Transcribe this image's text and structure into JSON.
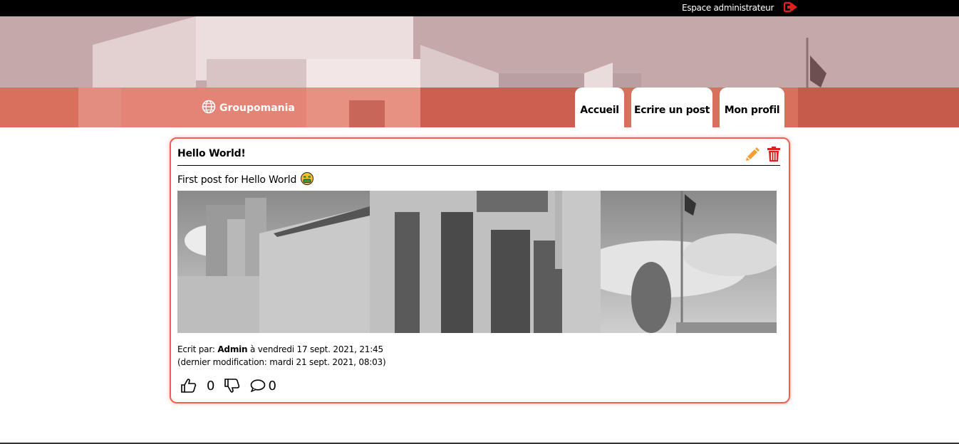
{
  "topbar": {
    "admin_label": "Espace administrateur",
    "logout_icon": "sign-out-icon"
  },
  "banner": {
    "brand_name": "Groupomania",
    "brand_icon": "globe-icon",
    "tabs": [
      {
        "label": "Accueil"
      },
      {
        "label": "Ecrire un post"
      },
      {
        "label": "Mon profil"
      }
    ]
  },
  "post": {
    "title": "Hello World!",
    "body": "First post for Hello World",
    "emoji": "money-mouth-face-icon",
    "meta_prefix": "Ecrit par:",
    "author": "Admin",
    "meta_date": "à vendredi 17 sept. 2021, 21:45",
    "modified": "(dernier modification: mardi 21 sept. 2021, 08:03)",
    "likes": "0",
    "comments": "0"
  },
  "colors": {
    "accent": "#f0604f",
    "banner_band": "#d9705e",
    "edit": "#f0a030",
    "delete": "#e02020"
  }
}
